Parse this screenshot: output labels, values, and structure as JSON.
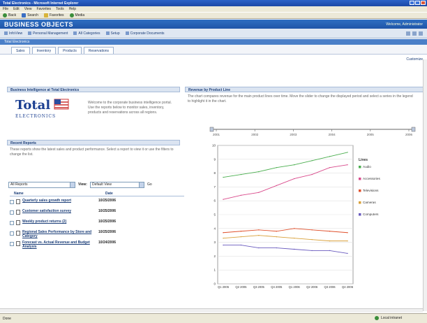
{
  "window": {
    "title": "Total Electronics - Microsoft Internet Explorer",
    "menu": [
      "File",
      "Edit",
      "View",
      "Favorites",
      "Tools",
      "Help"
    ],
    "toolbar": [
      "Back",
      "Search",
      "Favorites",
      "Media"
    ]
  },
  "app": {
    "brand": "BUSINESS OBJECTS",
    "welcome": "Welcome, Administrator",
    "nav": [
      "InfoView",
      "Personal Management",
      "All Categories",
      "Setup",
      "Corporate Documents"
    ],
    "document_bar": "Total Electronics",
    "tabs": [
      "Sales",
      "Inventory",
      "Products",
      "Reservations"
    ],
    "corner_link": "Customize"
  },
  "panel_intro": {
    "title": "Business Intelligence at Total Electronics",
    "logo_line1": "Total",
    "logo_line2": "ELECTRONICS",
    "description": "Welcome to the corporate business intelligence portal. Use the reports below to monitor sales, inventory, products and reservations across all regions."
  },
  "panel_reports": {
    "title": "Recent Reports",
    "description": "These reports show the latest sales and product performance. Select a report to view it or use the filters to change the list."
  },
  "filters": {
    "category": "All Reports",
    "view_label": "View:",
    "view_value": "Default View",
    "go_label": "Go"
  },
  "list": {
    "columns": [
      "Name",
      "Date"
    ],
    "rows": [
      {
        "name": "Quarterly sales growth report",
        "date": "10/25/2006"
      },
      {
        "name": "Customer satisfaction survey",
        "date": "10/25/2006"
      },
      {
        "name": "Weekly product returns (2)",
        "date": "10/25/2006"
      },
      {
        "name": "Regional Sales Performance by Store and Category",
        "date": "10/25/2006"
      },
      {
        "name": "Forecast vs. Actual Revenue and Budget Analysis",
        "date": "10/24/2006"
      }
    ]
  },
  "panel_chart": {
    "title": "Revenue by Product Line",
    "description": "The chart compares revenue for the main product lines over time. Move the slider to change the displayed period and select a series in the legend to highlight it in the chart."
  },
  "slider": {
    "labels": [
      "2001",
      "2002",
      "2003",
      "2004",
      "2005",
      "2006"
    ]
  },
  "chart_data": {
    "type": "line",
    "x": [
      "Q1 2005",
      "Q2 2005",
      "Q3 2005",
      "Q4 2005",
      "Q1 2006",
      "Q2 2006",
      "Q3 2006",
      "Q4 2006"
    ],
    "ylim": [
      0,
      10
    ],
    "y_ticks": [
      "0",
      "1",
      "2",
      "3",
      "4",
      "5",
      "6",
      "7",
      "8",
      "9",
      "10"
    ],
    "legend_title": "Lines",
    "legend_position": "right",
    "grid": true,
    "series": [
      {
        "name": "Audio",
        "color": "#4caf50",
        "values": [
          7.7,
          7.9,
          8.1,
          8.4,
          8.6,
          8.9,
          9.2,
          9.5
        ]
      },
      {
        "name": "Accessories",
        "color": "#d94b8c",
        "values": [
          6.1,
          6.4,
          6.6,
          7.1,
          7.6,
          7.9,
          8.4,
          8.6
        ]
      },
      {
        "name": "Televisions",
        "color": "#e0502c",
        "values": [
          3.7,
          3.8,
          3.9,
          3.8,
          4.0,
          3.9,
          3.8,
          3.7
        ]
      },
      {
        "name": "Cameras",
        "color": "#d9a13a",
        "values": [
          3.3,
          3.4,
          3.5,
          3.4,
          3.3,
          3.2,
          3.1,
          3.1
        ]
      },
      {
        "name": "Computers",
        "color": "#6a5bbf",
        "values": [
          2.8,
          2.8,
          2.6,
          2.6,
          2.5,
          2.4,
          2.4,
          2.2
        ]
      }
    ]
  },
  "status": {
    "text": "Done",
    "zone": "Local intranet"
  }
}
